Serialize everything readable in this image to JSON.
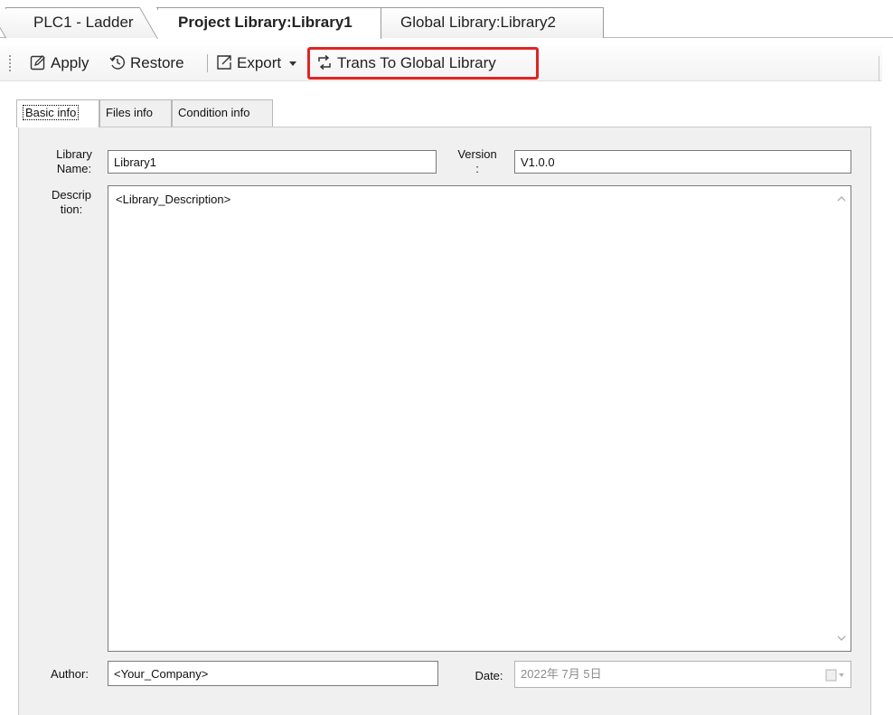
{
  "editor_tabs": [
    {
      "label": "PLC1 - Ladder"
    },
    {
      "label": "Project Library:Library1"
    },
    {
      "label": "Global Library:Library2"
    }
  ],
  "toolbar": {
    "apply_label": "Apply",
    "restore_label": "Restore",
    "export_label": "Export",
    "trans_label": "Trans To Global Library",
    "highlight_color": "#e02424",
    "icons": [
      "edit-icon",
      "restore-icon",
      "export-icon",
      "dropdown-arrow-icon",
      "transfer-icon"
    ]
  },
  "sub_tabs": [
    {
      "label": "Basic info"
    },
    {
      "label": "Files info"
    },
    {
      "label": "Condition info"
    }
  ],
  "form": {
    "library_name_label_1": "Library",
    "library_name_label_2": "Name:",
    "library_name_value": "Library1",
    "version_label_1": "Version",
    "version_label_2": ":",
    "version_value": "V1.0.0",
    "description_label_1": "Descrip",
    "description_label_2": "tion:",
    "description_value": "<Library_Description>",
    "author_label": "Author:",
    "author_value": "<Your_Company>",
    "date_label": "Date:",
    "date_value": "2022年 7月 5日"
  }
}
